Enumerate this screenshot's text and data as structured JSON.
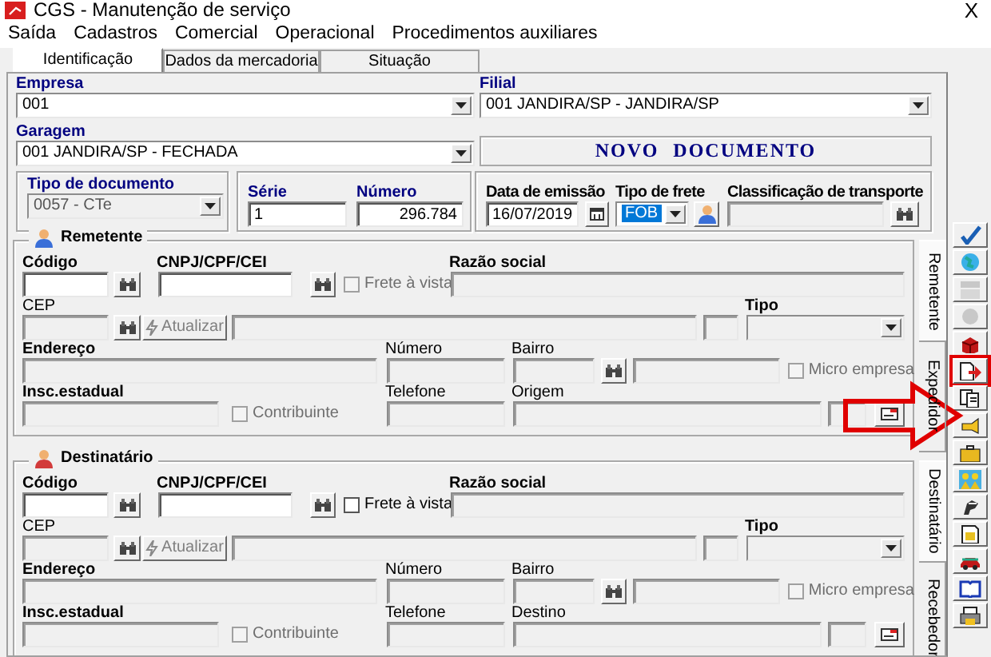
{
  "window": {
    "title": "CGS - Manutenção de serviço",
    "close": "X"
  },
  "menu": [
    "Saída",
    "Cadastros",
    "Comercial",
    "Operacional",
    "Procedimentos auxiliares"
  ],
  "tabs": [
    {
      "label": "Identificação",
      "selected": true
    },
    {
      "label": "Dados da mercadoria",
      "selected": false
    },
    {
      "label": "Situação",
      "selected": false
    }
  ],
  "header": {
    "empresa": {
      "label": "Empresa",
      "value": "001"
    },
    "filial": {
      "label": "Filial",
      "value": "001 JANDIRA/SP - JANDIRA/SP"
    },
    "garagem": {
      "label": "Garagem",
      "value": "001 JANDIRA/SP - FECHADA"
    },
    "status": "NOVO DOCUMENTO",
    "tipo_documento": {
      "label": "Tipo de documento",
      "value": "0057 - CTe"
    },
    "serie": {
      "label": "Série",
      "value": "1"
    },
    "numero": {
      "label": "Número",
      "value": "296.784"
    },
    "data_emissao": {
      "label": "Data de emissão",
      "value": "16/07/2019"
    },
    "tipo_frete": {
      "label": "Tipo de frete",
      "value": "FOB",
      "focused": true
    },
    "classificacao": {
      "label": "Classificação de transporte"
    }
  },
  "parties": [
    {
      "kind": "sender",
      "title": "Remetente",
      "codigo": "Código",
      "cnpj": "CNPJ/CPF/CEI",
      "frete": {
        "label": "Frete à vista",
        "checked": false,
        "disabled": true
      },
      "razao": "Razão social",
      "cep": "CEP",
      "atualizar": "Atualizar",
      "tipo": "Tipo",
      "endereco": "Endereço",
      "numero": "Número",
      "bairro": "Bairro",
      "micro": {
        "label": "Micro empresa",
        "checked": false,
        "disabled": true
      },
      "insc": "Insc.estadual",
      "contribuinte": {
        "label": "Contribuinte",
        "checked": false,
        "disabled": true
      },
      "telefone": "Telefone",
      "local": "Origem",
      "side_tabs": [
        {
          "label": "Remetente",
          "selected": true
        },
        {
          "label": "Expedidor",
          "selected": false
        }
      ]
    },
    {
      "kind": "recipient",
      "title": "Destinatário",
      "codigo": "Código",
      "cnpj": "CNPJ/CPF/CEI",
      "frete": {
        "label": "Frete à vista",
        "checked": false,
        "disabled": false
      },
      "razao": "Razão social",
      "cep": "CEP",
      "atualizar": "Atualizar",
      "tipo": "Tipo",
      "endereco": "Endereço",
      "numero": "Número",
      "bairro": "Bairro",
      "micro": {
        "label": "Micro empresa",
        "checked": false,
        "disabled": true
      },
      "insc": "Insc.estadual",
      "contribuinte": {
        "label": "Contribuinte",
        "checked": false,
        "disabled": true
      },
      "telefone": "Telefone",
      "local": "Destino",
      "side_tabs": [
        {
          "label": "Destinatário",
          "selected": true
        },
        {
          "label": "Recebedor",
          "selected": false
        }
      ]
    }
  ],
  "toolbar": [
    {
      "disabled": false,
      "highlighted": false
    },
    {
      "disabled": false,
      "highlighted": false
    },
    {
      "disabled": true,
      "highlighted": false
    },
    {
      "disabled": true,
      "highlighted": false
    },
    {
      "disabled": false,
      "highlighted": false
    },
    {
      "disabled": false,
      "highlighted": true
    },
    {
      "disabled": false,
      "highlighted": false
    },
    {
      "disabled": false,
      "highlighted": false
    },
    {
      "disabled": false,
      "highlighted": false
    },
    {
      "disabled": false,
      "highlighted": false
    },
    {
      "disabled": false,
      "highlighted": false
    },
    {
      "disabled": false,
      "highlighted": false
    },
    {
      "disabled": false,
      "highlighted": false
    },
    {
      "disabled": false,
      "highlighted": false
    },
    {
      "disabled": false,
      "highlighted": false
    }
  ]
}
